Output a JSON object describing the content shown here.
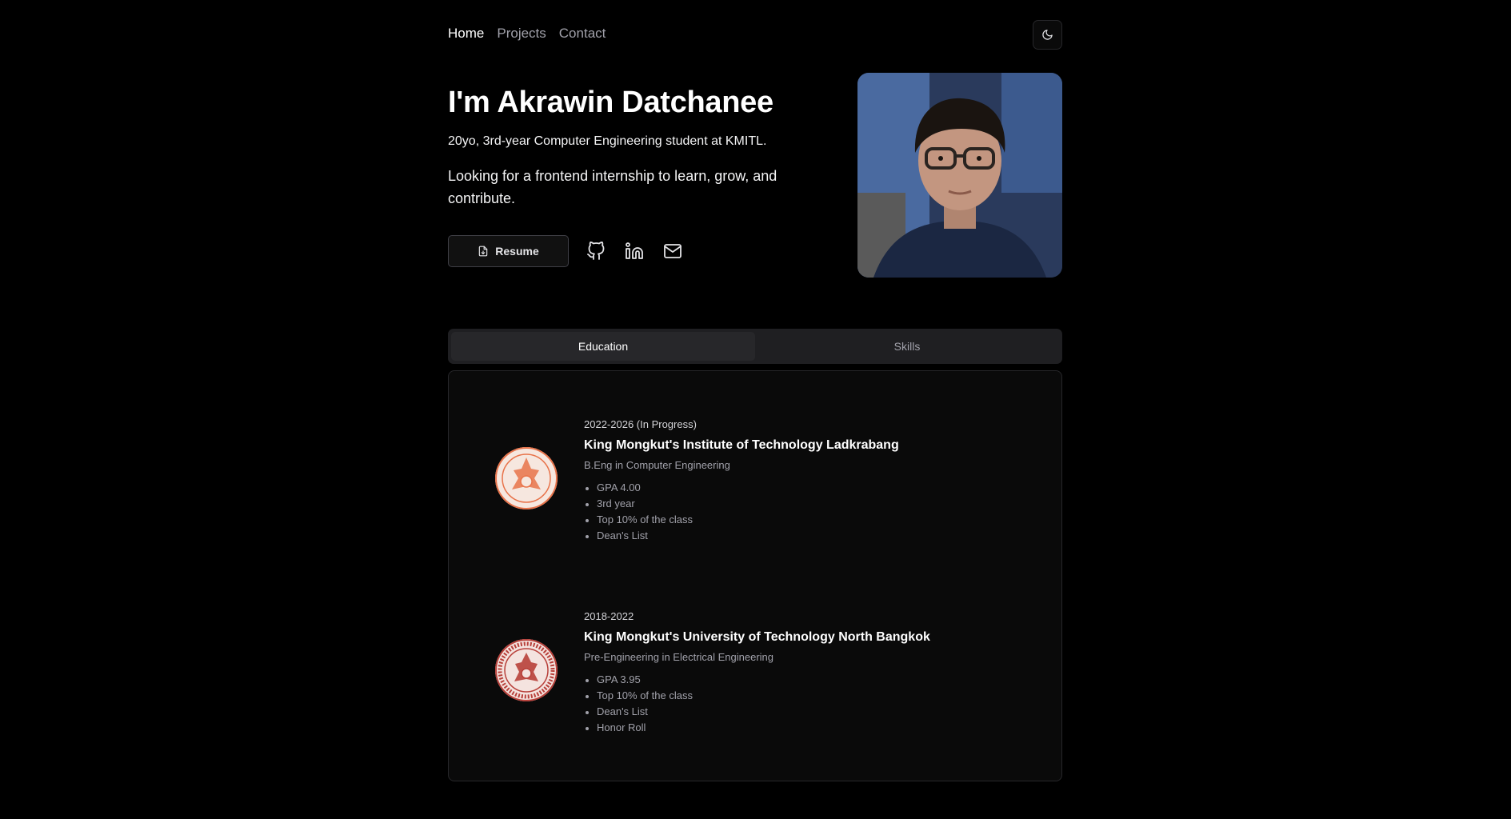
{
  "nav": {
    "links": [
      {
        "label": "Home",
        "active": true
      },
      {
        "label": "Projects",
        "active": false
      },
      {
        "label": "Contact",
        "active": false
      }
    ],
    "theme_toggle_icon": "moon-icon"
  },
  "hero": {
    "title": "I'm Akrawin Datchanee",
    "subtitle": "20yo, 3rd-year Computer Engineering student at KMITL.",
    "description": "Looking for a frontend internship to learn, grow, and contribute.",
    "resume_label": "Resume",
    "social_icons": [
      "github-icon",
      "linkedin-icon",
      "mail-icon"
    ]
  },
  "tabs": [
    {
      "label": "Education",
      "active": true
    },
    {
      "label": "Skills",
      "active": false
    }
  ],
  "education": [
    {
      "period": "2022-2026 (In Progress)",
      "school": "King Mongkut's Institute of Technology Ladkrabang",
      "degree": "B.Eng in Computer Engineering",
      "highlights": [
        "GPA 4.00",
        "3rd year",
        "Top 10% of the class",
        "Dean's List"
      ],
      "seal_color": "#e8734a"
    },
    {
      "period": "2018-2022",
      "school": "King Mongkut's University of Technology North Bangkok",
      "degree": "Pre-Engineering in Electrical Engineering",
      "highlights": [
        "GPA 3.95",
        "Top 10% of the class",
        "Dean's List",
        "Honor Roll"
      ],
      "seal_color": "#b8403a"
    }
  ],
  "colors": {
    "background": "#000000",
    "card": "#0a0a0a",
    "border": "#27272a",
    "muted_text": "#a1a1aa"
  }
}
